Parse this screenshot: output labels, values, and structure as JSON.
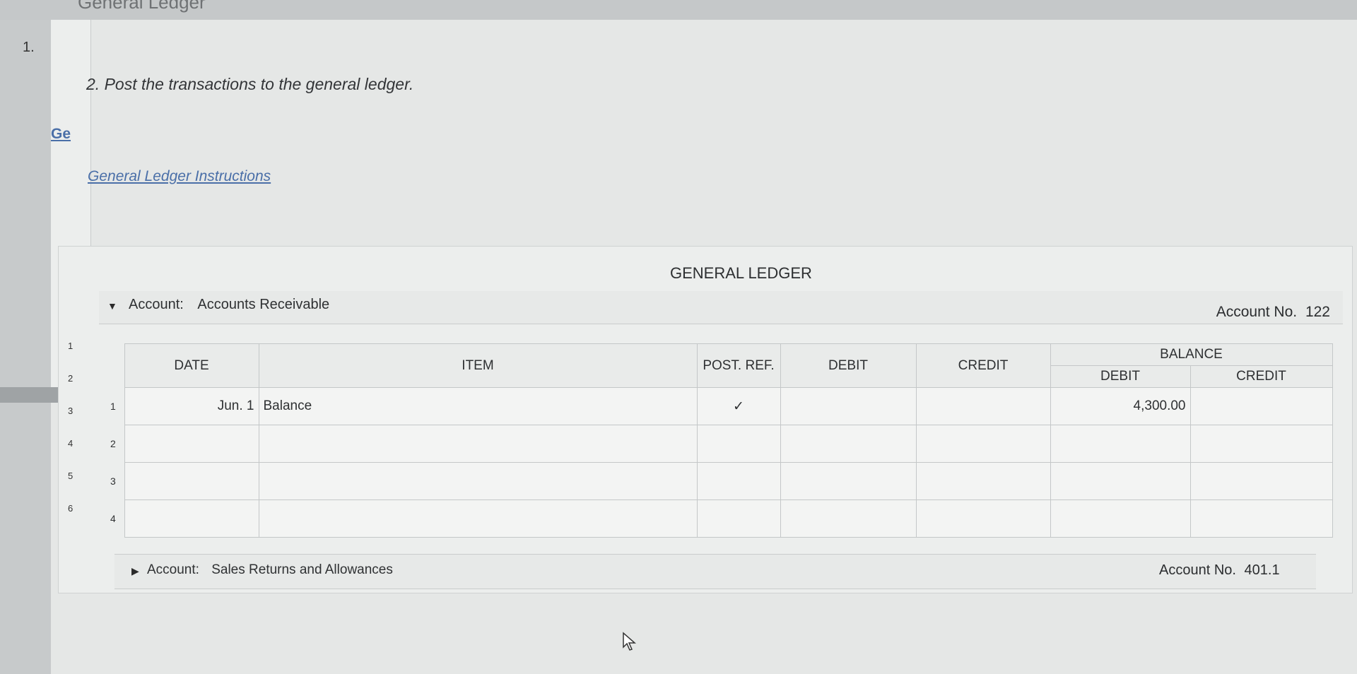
{
  "header": {
    "page_heading": "General Ledger",
    "question_number": "1.",
    "instruction": "2. Post the transactions to the general ledger.",
    "ge_link": "Ge",
    "instructions_link": "General Ledger Instructions"
  },
  "ledger": {
    "title": "GENERAL LEDGER",
    "account_label": "Account:",
    "account_name": "Accounts Receivable",
    "account_no_label": "Account No.",
    "account_no": "122",
    "columns": {
      "date": "DATE",
      "item": "ITEM",
      "post_ref": "POST. REF.",
      "debit": "DEBIT",
      "credit": "CREDIT",
      "balance": "BALANCE",
      "balance_debit": "DEBIT",
      "balance_credit": "CREDIT"
    },
    "rows": [
      {
        "num": "1",
        "date": "Jun. 1",
        "item": "Balance",
        "post_ref": "✓",
        "debit": "",
        "credit": "",
        "bal_debit": "4,300.00",
        "bal_credit": ""
      },
      {
        "num": "2",
        "date": "",
        "item": "",
        "post_ref": "",
        "debit": "",
        "credit": "",
        "bal_debit": "",
        "bal_credit": ""
      },
      {
        "num": "3",
        "date": "",
        "item": "",
        "post_ref": "",
        "debit": "",
        "credit": "",
        "bal_debit": "",
        "bal_credit": ""
      },
      {
        "num": "4",
        "date": "",
        "item": "",
        "post_ref": "",
        "debit": "",
        "credit": "",
        "bal_debit": "",
        "bal_credit": ""
      }
    ],
    "gutter_numbers": [
      "1",
      "2",
      "3",
      "4",
      "5",
      "6"
    ],
    "account2_label": "Account:",
    "account2_name": "Sales Returns and Allowances",
    "account2_no_label": "Account No.",
    "account2_no": "401.1"
  }
}
